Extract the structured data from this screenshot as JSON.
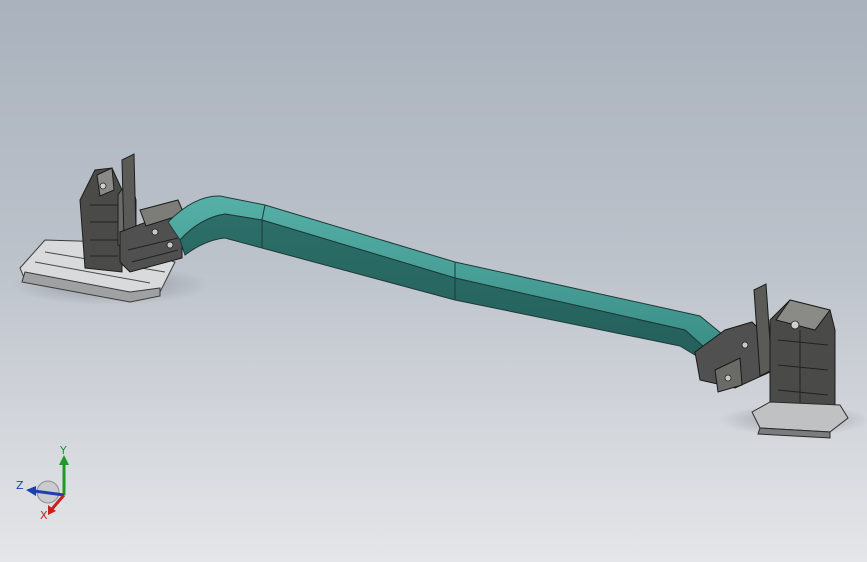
{
  "viewport": {
    "background_top": "#a9b2bd",
    "background_bottom": "#e4e6e9",
    "model": {
      "beam_color": "#2f7f78",
      "beam_highlight": "#4fa9a0",
      "fixture_color": "#4a4a48"
    }
  },
  "triad": {
    "x_label": "X",
    "y_label": "Y",
    "z_label": "Z",
    "x_color": "#c8201e",
    "y_color": "#1d9a2a",
    "z_color": "#1f3fb0"
  }
}
